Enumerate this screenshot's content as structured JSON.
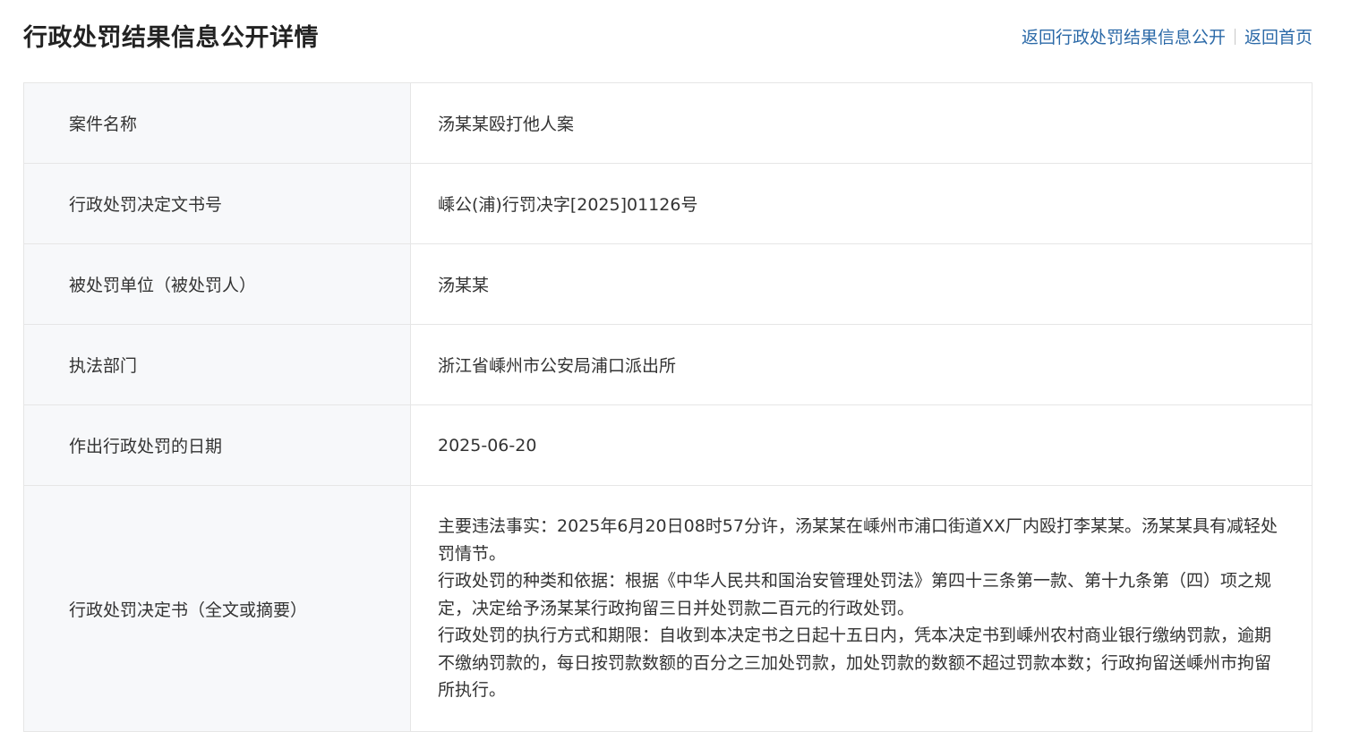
{
  "header": {
    "title": "行政处罚结果信息公开详情",
    "link_back_list": "返回行政处罚结果信息公开",
    "link_home": "返回首页"
  },
  "rows": [
    {
      "label": "案件名称",
      "value": "汤某某殴打他人案"
    },
    {
      "label": "行政处罚决定文书号",
      "value": "嵊公(浦)行罚决字[2025]01126号"
    },
    {
      "label": "被处罚单位（被处罚人）",
      "value": "汤某某"
    },
    {
      "label": "执法部门",
      "value": "浙江省嵊州市公安局浦口派出所"
    },
    {
      "label": "作出行政处罚的日期",
      "value": "2025-06-20"
    }
  ],
  "decision": {
    "label": "行政处罚决定书（全文或摘要）",
    "paragraphs": [
      "主要违法事实：2025年6月20日08时57分许，汤某某在嵊州市浦口街道XX厂内殴打李某某。汤某某具有减轻处罚情节。",
      "行政处罚的种类和依据：根据《中华人民共和国治安管理处罚法》第四十三条第一款、第十九条第（四）项之规定，决定给予汤某某行政拘留三日并处罚款二百元的行政处罚。",
      "行政处罚的执行方式和期限：自收到本决定书之日起十五日内，凭本决定书到嵊州农村商业银行缴纳罚款，逾期不缴纳罚款的，每日按罚款数额的百分之三加处罚款，加处罚款的数额不超过罚款本数；行政拘留送嵊州市拘留所执行。"
    ]
  },
  "colors": {
    "link": "#2c6aa8",
    "label_bg": "#f7f8fa",
    "border": "#e6e6e6"
  }
}
